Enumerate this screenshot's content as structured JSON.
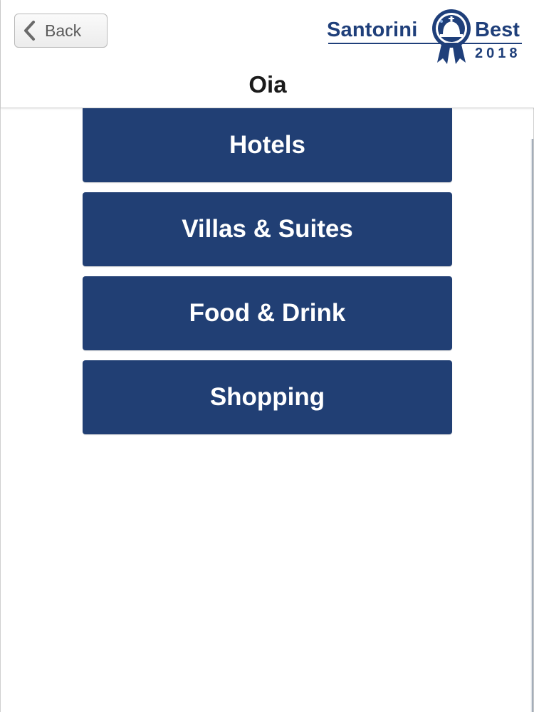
{
  "header": {
    "back_label": "Back",
    "title": "Oia"
  },
  "logo": {
    "word_left": "Santorini",
    "word_right": "Best",
    "year": "2018",
    "icon": "award-ribbon-icon"
  },
  "menu": {
    "items": [
      {
        "label": "Hotels"
      },
      {
        "label": "Villas & Suites"
      },
      {
        "label": "Food & Drink"
      },
      {
        "label": "Shopping"
      }
    ]
  },
  "colors": {
    "brand": "#213f74",
    "logo_blue": "#1f3f7a",
    "background": "#ffffff"
  }
}
